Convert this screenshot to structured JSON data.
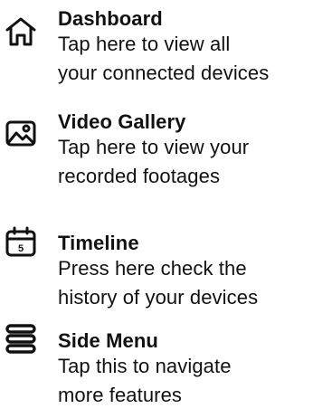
{
  "help_items": [
    {
      "icon": "home-icon",
      "title": "Dashboard",
      "desc_line1": "Tap here to view all",
      "desc_line2": "your connected devices"
    },
    {
      "icon": "gallery-icon",
      "title": "Video Gallery",
      "desc_line1": "Tap here to view your",
      "desc_line2": "recorded footages"
    },
    {
      "icon": "calendar-icon",
      "icon_text": "5",
      "title": "Timeline",
      "desc_line1": "Press here check the",
      "desc_line2": "history of your devices"
    },
    {
      "icon": "menu-icon",
      "title": "Side Menu",
      "desc_line1": "Tap this to navigate",
      "desc_line2": "more features"
    }
  ],
  "colors": {
    "text": "#111111",
    "background": "#ffffff"
  }
}
